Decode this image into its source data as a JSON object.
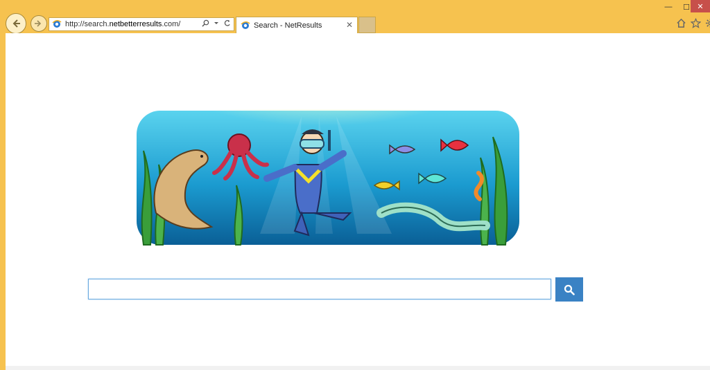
{
  "browser": {
    "address": {
      "url_prefix": "http://search.",
      "url_domain": "netbetterresults",
      "url_suffix": ".com/"
    },
    "tab": {
      "title": "Search - NetResults",
      "close": "✕"
    },
    "window_controls": {
      "minimize": "—",
      "maximize": "☐",
      "close": "✕"
    }
  },
  "page": {
    "search": {
      "value": "",
      "placeholder": ""
    },
    "colors": {
      "accent": "#3a82c4",
      "chrome": "#f6c24f"
    }
  }
}
